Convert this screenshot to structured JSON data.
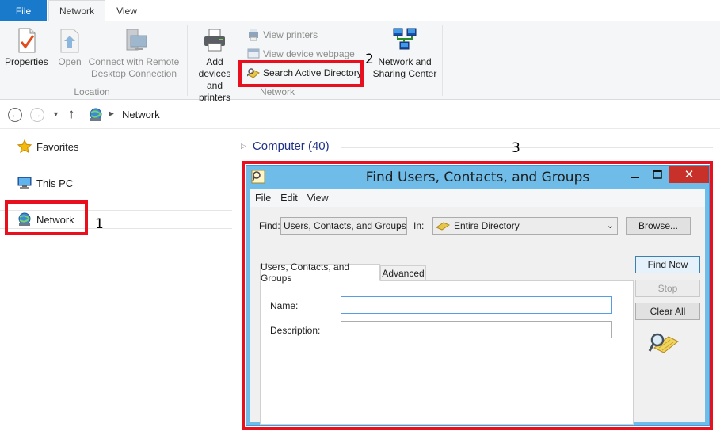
{
  "ribbon": {
    "tabs": [
      {
        "label": "File"
      },
      {
        "label": "Network"
      },
      {
        "label": "View"
      }
    ],
    "location_group": {
      "label": "Location",
      "buttons": [
        {
          "label_line1": "Properties",
          "label_line2": "",
          "icon": "properties-icon"
        },
        {
          "label_line1": "Open",
          "label_line2": "",
          "icon": "open-icon"
        },
        {
          "label_line1": "Connect with Remote",
          "label_line2": "Desktop Connection",
          "icon": "remote-desktop-icon"
        }
      ]
    },
    "network_group": {
      "label": "Network",
      "add_device": {
        "label_line1": "Add devices",
        "label_line2": "and printers",
        "icon": "printer-icon"
      },
      "small_buttons": [
        {
          "label": "View printers",
          "icon": "printers-icon"
        },
        {
          "label": "View device webpage",
          "icon": "webpage-icon"
        },
        {
          "label": "Search Active Directory",
          "icon": "search-directory-icon"
        }
      ]
    },
    "sharing_group": {
      "button": {
        "label_line1": "Network and",
        "label_line2": "Sharing Center",
        "icon": "sharing-center-icon"
      }
    }
  },
  "address": {
    "crumbs": [
      "Network"
    ]
  },
  "nav": {
    "items": [
      {
        "label": "Favorites",
        "icon": "star-icon"
      },
      {
        "label": "This PC",
        "icon": "computer-icon"
      },
      {
        "label": "Network",
        "icon": "network-globe-icon"
      }
    ]
  },
  "content": {
    "group_header": "Computer (40)"
  },
  "dialog": {
    "title": "Find Users, Contacts, and Groups",
    "menu": [
      "File",
      "Edit",
      "View"
    ],
    "find_label": "Find:",
    "find_value": "Users, Contacts, and Groups",
    "in_label": "In:",
    "in_value": "Entire Directory",
    "browse_label": "Browse...",
    "tabs": [
      "Users, Contacts, and Groups",
      "Advanced"
    ],
    "name_label": "Name:",
    "name_value": "",
    "description_label": "Description:",
    "description_value": "",
    "find_now_label": "Find Now",
    "stop_label": "Stop",
    "clear_all_label": "Clear All"
  },
  "annotations": {
    "step1": "1",
    "step2": "2",
    "step3": "3",
    "color": "#e8101e"
  },
  "colors": {
    "file_tab": "#1979ca",
    "dialog_frame": "#6fbce8",
    "close_button": "#c7312a",
    "link_header": "#1e3287"
  }
}
